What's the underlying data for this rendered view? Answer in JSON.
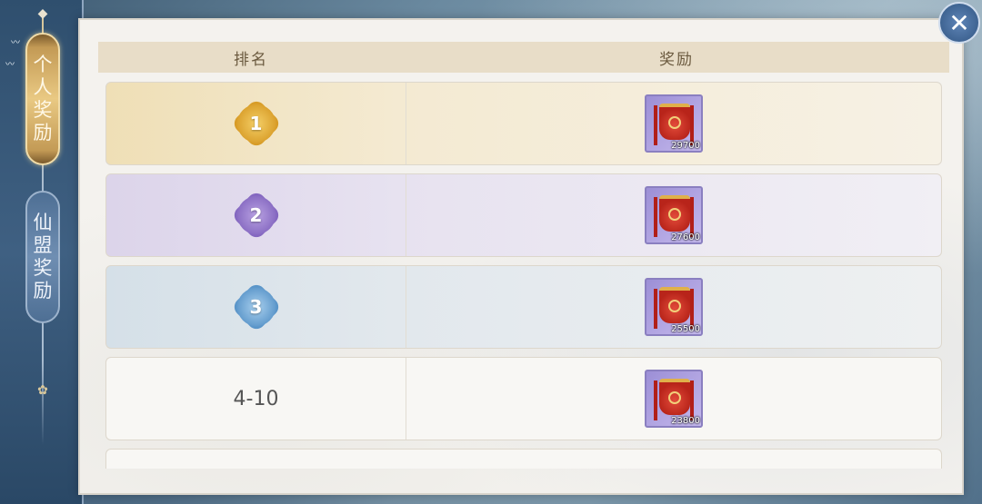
{
  "nav": {
    "tabs": [
      {
        "chars": [
          "个",
          "人",
          "奖",
          "励"
        ],
        "active": true
      },
      {
        "chars": [
          "仙",
          "盟",
          "奖",
          "励"
        ],
        "active": false
      }
    ]
  },
  "table": {
    "headers": {
      "rank": "排名",
      "reward": "奖励"
    },
    "rows": [
      {
        "rank": "1",
        "medal": "gold",
        "reward_count": "29700",
        "reward_icon": "red-banner-icon"
      },
      {
        "rank": "2",
        "medal": "purple",
        "reward_count": "27600",
        "reward_icon": "red-banner-icon"
      },
      {
        "rank": "3",
        "medal": "blue",
        "reward_count": "25500",
        "reward_icon": "red-banner-icon"
      },
      {
        "rank": "4-10",
        "medal": "none",
        "reward_count": "23800",
        "reward_icon": "red-banner-icon"
      }
    ]
  },
  "close": {
    "icon": "close-icon",
    "glyph": "✕"
  },
  "colors": {
    "gold_medal": "#d89c27",
    "purple_medal": "#8467c0",
    "blue_medal": "#5a95c9",
    "header_bg": "#e8ddc8",
    "active_tab": "#e9c983",
    "inactive_tab": "#6f8eb2"
  }
}
